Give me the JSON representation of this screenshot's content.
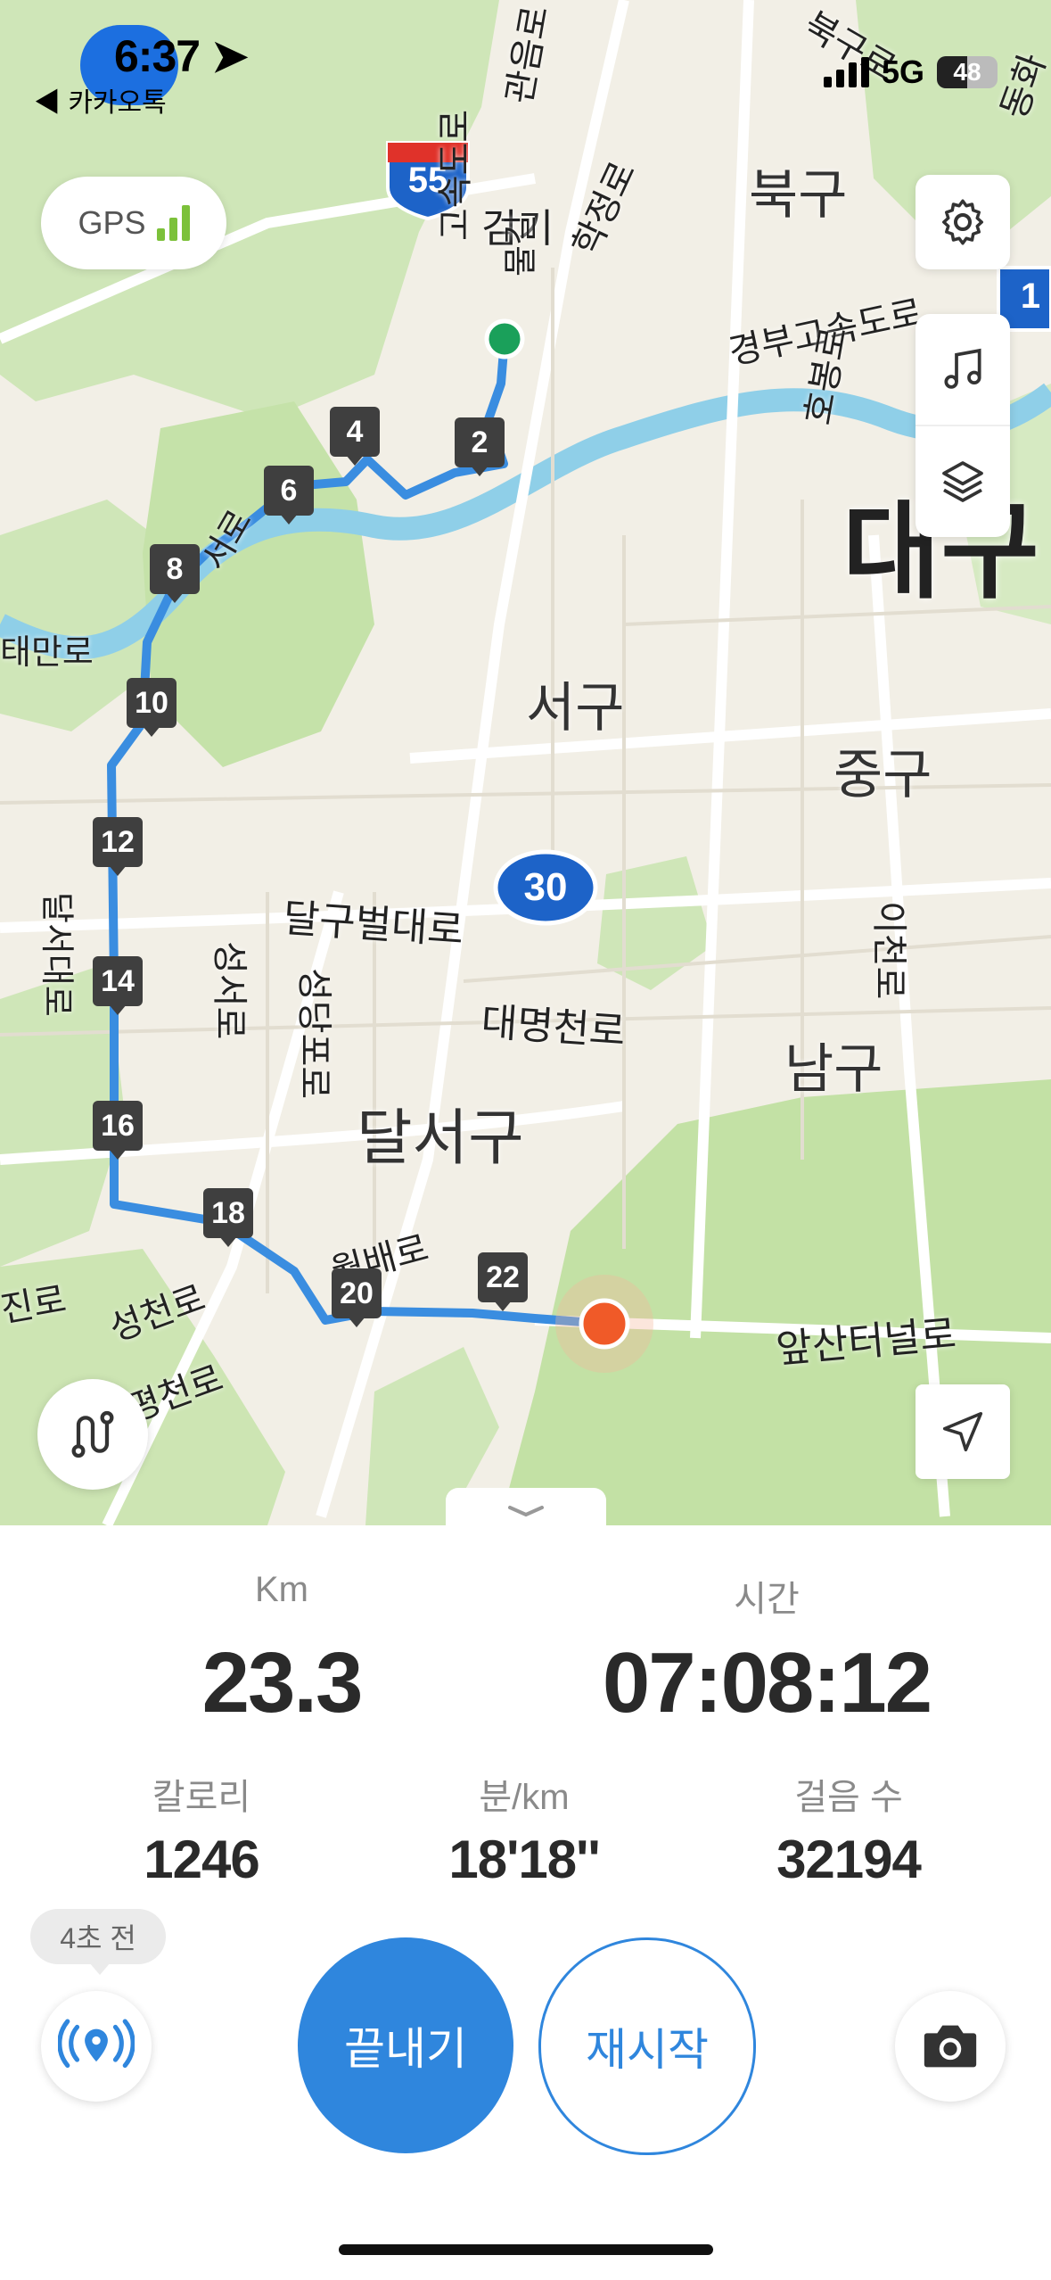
{
  "status_bar": {
    "time": "6:37",
    "back_app": "◀ 카카오톡",
    "network": "5G",
    "battery": "48"
  },
  "map": {
    "gps_label": "GPS",
    "places": {
      "bukgu": "북구",
      "seogu": "서구",
      "junggu": "중구",
      "namgu": "남구",
      "dalseogu": "달서구",
      "daegu": "대구"
    },
    "roads": {
      "dalgubeol": "달구벌대로",
      "daemyeongcheon": "대명천로",
      "apsan_tunnel": "앞산터널로",
      "gyeongbu": "경부고속도로",
      "icheon": "이천로",
      "seongseo": "성서로",
      "seongdangpo": "성당포로",
      "gyeongbuk2": "고속도로",
      "hwangjeong": "학정로",
      "oknyeon": "호봉로",
      "daehak": "달서대로",
      "waebaero": "월배로",
      "seongcheon": "성천로",
      "jiro": "진로",
      "sachun": "평천로",
      "taeman": "태만로",
      "north1": "관음로",
      "gangi": "검기",
      "dong": "동화",
      "sam": "북구로",
      "gongmul": "물길",
      "seonhyo": "서로"
    },
    "shields": {
      "route55": "55",
      "route30": "30",
      "route1": "1"
    },
    "markers": [
      "2",
      "4",
      "6",
      "8",
      "10",
      "12",
      "14",
      "16",
      "18",
      "20",
      "22"
    ]
  },
  "stats": {
    "distance_label": "Km",
    "distance_value": "23.3",
    "time_label": "시간",
    "time_value": "07:08:12",
    "calorie_label": "칼로리",
    "calorie_value": "1246",
    "pace_label": "분/km",
    "pace_value": "18'18''",
    "steps_label": "걸음 수",
    "steps_value": "32194"
  },
  "controls": {
    "ago_text": "4초 전",
    "finish_label": "끝내기",
    "restart_label": "재시작"
  },
  "colors": {
    "accent": "#2f86dd",
    "route": "#3a8de0",
    "start_dot": "#1aa05a",
    "end_dot": "#f05a28",
    "marker_bg": "#3f3f3f",
    "gps_bars": "#7cc13a"
  }
}
